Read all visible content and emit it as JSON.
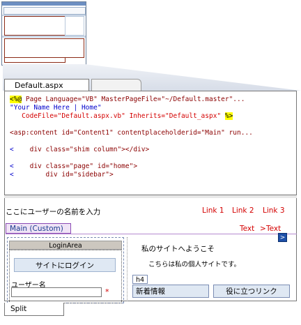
{
  "tabs": {
    "active": "Default.aspx"
  },
  "code": {
    "line1_open": "<%@",
    "line1_rest": " Page Language=\"VB\" MasterPageFile=\"~/Default.master\"...",
    "line2": "\"Your Name Here | Home\"",
    "line3_text": "   CodeFile=\"Default.aspx.vb\" Inherits=\"Default_aspx\" ",
    "line3_close": "%>",
    "line5": "<asp:content id=\"Content1\" contentplaceholderid=\"Main\" run...",
    "line7_lt": "<",
    "line7_text": "    div class=\"shim column\"></div>",
    "line9_lt": "<",
    "line9_text": "    div class=\"page\" id=\"home\">",
    "line10_lt": "<",
    "line10_text": "        div id=\"sidebar\">"
  },
  "design": {
    "placeholder_text": "ここにユーザーの名前を入力",
    "links": [
      "Link 1",
      "Link 2",
      "Link 3"
    ],
    "main_tab": "Main (Custom)",
    "breadcrumb": {
      "a": "Text",
      "sep": ">",
      "b": "Text"
    },
    "login_area": "LoginArea",
    "login_title": "サイトにログイン",
    "user_label": "ユーザー名",
    "required_mark": "*",
    "welcome": "私のサイトへようこそ",
    "intro": "こちらは私の個人サイトです。",
    "h4": "h4",
    "news": "新着情報",
    "useful_links": "役に立つリンク",
    "arrow": ">"
  },
  "bottom_tab": "Split"
}
